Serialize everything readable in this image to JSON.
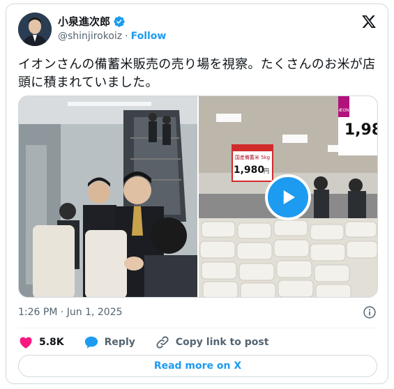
{
  "author": {
    "display_name": "小泉進次郎",
    "handle": "@shinjirokoiz",
    "separator": "·",
    "follow_label": "Follow"
  },
  "tweet": {
    "text": "イオンさんの備蓄米販売の売り場を視察。たくさんのお米が店頭に積まれていました。"
  },
  "media": {
    "left_image": "photo of people holding rice bags near escalator",
    "right_image": "video thumbnail of rice bags stacked on store floor",
    "signs": {
      "sign_price": "1,980",
      "sign_price_unit": "円",
      "sign_product": "国産備蓄米 5kg",
      "sign_brand": "ÆON",
      "corner_price": "1,98"
    }
  },
  "meta": {
    "timestamp": "1:26 PM · Jun 1, 2025"
  },
  "actions": {
    "like_count": "5.8K",
    "reply_label": "Reply",
    "copy_label": "Copy link to post"
  },
  "read_more_label": "Read more on X",
  "colors": {
    "accent": "#1d9bf0",
    "like": "#f91880",
    "text": "#0f1419",
    "muted": "#536471"
  }
}
